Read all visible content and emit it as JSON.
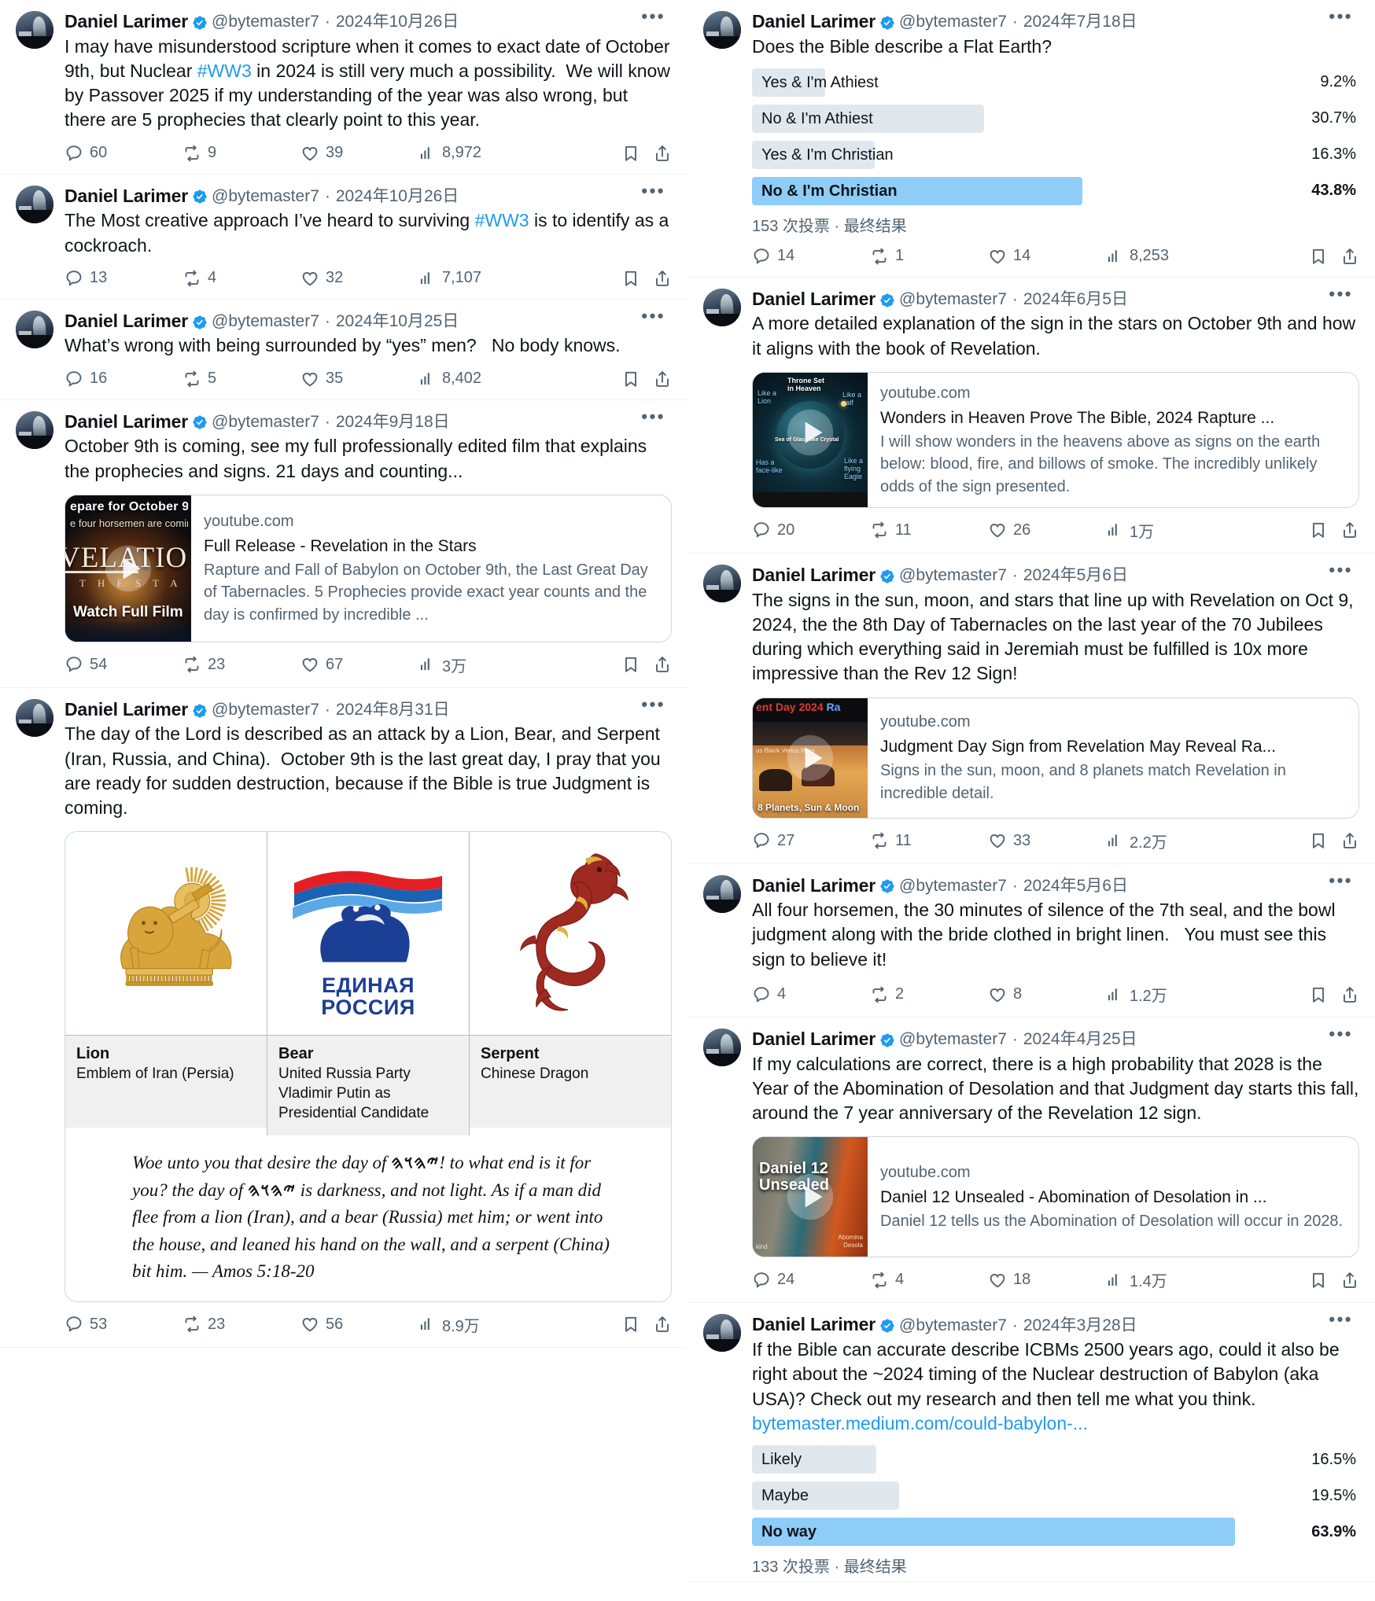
{
  "author": {
    "name": "Daniel Larimer",
    "handle": "@bytemaster7",
    "verified_icon": "verified-badge-icon"
  },
  "separator": "·",
  "left_column": [
    {
      "date": "2024年10月26日",
      "text_parts": [
        {
          "t": "I may have misunderstood scripture when it comes to exact date of October 9th, but Nuclear "
        },
        {
          "t": "#WW3",
          "link": true
        },
        {
          "t": " in 2024 is still very much a possibility.  We will know by Passover 2025 if my understanding of the year was also wrong, but there are 5 prophecies that clearly point to this year."
        }
      ],
      "stats": {
        "replies": "60",
        "retweets": "9",
        "likes": "39",
        "views": "8,972"
      }
    },
    {
      "date": "2024年10月26日",
      "text_parts": [
        {
          "t": "The Most creative approach I’ve heard to surviving "
        },
        {
          "t": "#WW3",
          "link": true
        },
        {
          "t": " is to identify as a cockroach."
        }
      ],
      "stats": {
        "replies": "13",
        "retweets": "4",
        "likes": "32",
        "views": "7,107"
      }
    },
    {
      "date": "2024年10月25日",
      "text_parts": [
        {
          "t": "What’s wrong with being surrounded by “yes” men?   No body knows."
        }
      ],
      "stats": {
        "replies": "16",
        "retweets": "5",
        "likes": "35",
        "views": "8,402"
      }
    },
    {
      "date": "2024年9月18日",
      "text_parts": [
        {
          "t": "October 9th is coming, see my full professionally edited film that explains the prophecies and signs. 21 days and counting..."
        }
      ],
      "card": {
        "domain": "youtube.com",
        "title": "Full Release - Revelation in the Stars",
        "desc": "Rapture and Fall of Babylon on October 9th, the Last Great Day of Tabernacles. 5 Prophecies provide exact year counts and the day is confirmed by incredible ...",
        "thumb": "revelation-thumbnail",
        "thumb_text": {
          "line1": "epare for October 9",
          "line2": "e four horsemen are coming",
          "big": "VELATIO",
          "sub": "T H E  S T A",
          "watch": "Watch Full Film"
        }
      },
      "stats": {
        "replies": "54",
        "retweets": "23",
        "likes": "67",
        "views": "3万"
      }
    },
    {
      "date": "2024年8月31日",
      "text_parts": [
        {
          "t": "The day of the Lord is described as an attack by a Lion, Bear, and Serpent (Iran, Russia, and China).  October 9th is the last great day, I pray that you are ready for sudden destruction, because if the Bible is true Judgment is coming."
        }
      ],
      "collage": {
        "cells": [
          {
            "title": "Lion",
            "desc": "Emblem of Iran (Persia)",
            "art": "iran-lion-sun-emblem"
          },
          {
            "title": "Bear",
            "desc": "United Russia Party\nVladimir Putin as\nPresidential Candidate",
            "art": "united-russia-bear-logo",
            "logo_text": "ЕДИНАЯ\nРОССИЯ"
          },
          {
            "title": "Serpent",
            "desc": "Chinese Dragon",
            "art": "chinese-dragon-emblem"
          }
        ],
        "quote_parts": [
          {
            "t": "Woe unto you that desire the day of "
          },
          {
            "t": "𐤉𐤄𐤅𐤄",
            "yhwh": true
          },
          {
            "t": "! to what end is it for you? the day of "
          },
          {
            "t": "𐤉𐤄𐤅𐤄",
            "yhwh": true
          },
          {
            "t": " is darkness, and not light. As if a man did flee from a lion (Iran), and a bear (Russia) met him; or went into the house, and leaned his hand on the wall, and a serpent (China) bit him. — Amos 5:18-20"
          }
        ]
      },
      "stats": {
        "replies": "53",
        "retweets": "23",
        "likes": "56",
        "views": "8.9万"
      }
    }
  ],
  "right_column": [
    {
      "date": "2024年7月18日",
      "text_parts": [
        {
          "t": "Does the Bible describe a Flat Earth?"
        }
      ],
      "poll": {
        "options": [
          {
            "label": "Yes & I'm Athiest",
            "pct": "9.2%",
            "value": 9.2,
            "winner": false
          },
          {
            "label": "No & I'm Athiest",
            "pct": "30.7%",
            "value": 30.7,
            "winner": false
          },
          {
            "label": "Yes & I'm Christian",
            "pct": "16.3%",
            "value": 16.3,
            "winner": false
          },
          {
            "label": "No & I'm Christian",
            "pct": "43.8%",
            "value": 43.8,
            "winner": true
          }
        ],
        "meta": "153 次投票 · 最终结果"
      },
      "stats": {
        "replies": "14",
        "retweets": "1",
        "likes": "14",
        "views": "8,253"
      }
    },
    {
      "date": "2024年6月5日",
      "text_parts": [
        {
          "t": "A more detailed explanation of the sign in the stars on October 9th and how it aligns with the book of Revelation."
        }
      ],
      "card": {
        "domain": "youtube.com",
        "title": "Wonders in Heaven Prove The Bible, 2024 Rapture ...",
        "desc": "I will show wonders in the heavens above as signs on the earth below: blood, fire, and billows of smoke. The incredibly unlikely odds of the sign presented.",
        "thumb": "wonders-in-heaven-thumbnail",
        "thumb_text": {
          "throne": "Throne Set\nin Heaven",
          "lion": "Like a\nLion",
          "calf": "Like a\ncalf",
          "sea": "Sea of Glass like Crystal",
          "face": "Has a\nface-like",
          "eagle": "Like a\nflying\nEagle"
        }
      },
      "stats": {
        "replies": "20",
        "retweets": "11",
        "likes": "26",
        "views": "1万"
      }
    },
    {
      "date": "2024年5月6日",
      "text_parts": [
        {
          "t": "The signs in the sun, moon, and stars that line up with Revelation on Oct 9, 2024, the the 8th Day of Tabernacles on the last year of the 70 Jubilees during which everything said in Jeremiah must be fulfilled is 10x more impressive than the Rev 12 Sign!"
        }
      ],
      "card": {
        "domain": "youtube.com",
        "title": "Judgment Day Sign from Revelation May Reveal Ra...",
        "desc": "Signs in the sun, moon, and 8 planets match Revelation in incredible detail.",
        "thumb": "judgment-day-thumbnail",
        "thumb_text": {
          "top": "ent Day 2024",
          "top_blue": "Ra",
          "planets": "us  Black Venus  Mars",
          "caption": "8 Planets, Sun & Moon"
        }
      },
      "stats": {
        "replies": "27",
        "retweets": "11",
        "likes": "33",
        "views": "2.2万"
      }
    },
    {
      "date": "2024年5月6日",
      "text_parts": [
        {
          "t": "All four horsemen, the 30 minutes of silence of the 7th seal, and the bowl judgment along with the bride clothed in bright linen.   You must see this sign to believe it!"
        }
      ],
      "stats": {
        "replies": "4",
        "retweets": "2",
        "likes": "8",
        "views": "1.2万"
      }
    },
    {
      "date": "2024年4月25日",
      "text_parts": [
        {
          "t": "If my calculations are correct, there is a high probability that 2028 is the Year of the Abomination of Desolation and that Judgment day starts this fall, around the 7 year anniversary of the Revelation 12 sign."
        }
      ],
      "card": {
        "domain": "youtube.com",
        "title": "Daniel 12 Unsealed - Abomination of Desolation in ...",
        "desc": "Daniel 12 tells us the Abomination of Desolation will occur in 2028.",
        "thumb": "daniel-12-unsealed-thumbnail",
        "thumb_text": {
          "title": "Daniel 12\nUnsealed",
          "right": "Abomina\nDesola",
          "left": "kind"
        }
      },
      "stats": {
        "replies": "24",
        "retweets": "4",
        "likes": "18",
        "views": "1.4万"
      }
    },
    {
      "date": "2024年3月28日",
      "text_parts": [
        {
          "t": "If the Bible can accurate describe ICBMs 2500 years ago, could it also be right about the ~2024 timing of the Nuclear destruction of Babylon (aka USA)? Check out my research and then tell me what you think.\n"
        },
        {
          "t": "bytemaster.medium.com/could-babylon-...",
          "link": true
        }
      ],
      "poll": {
        "options": [
          {
            "label": "Likely",
            "pct": "16.5%",
            "value": 16.5,
            "winner": false
          },
          {
            "label": "Maybe",
            "pct": "19.5%",
            "value": 19.5,
            "winner": false
          },
          {
            "label": "No way",
            "pct": "63.9%",
            "value": 63.9,
            "winner": true
          }
        ],
        "meta": "133 次投票 · 最终结果"
      }
    }
  ],
  "icons": {
    "reply": "reply-icon",
    "retweet": "retweet-icon",
    "like": "like-icon",
    "views": "views-icon",
    "bookmark": "bookmark-icon",
    "share": "share-icon",
    "more": "more-options-icon",
    "play": "play-button-icon"
  },
  "colors": {
    "link": "#1d9bf0",
    "verified": "#1d9bf0",
    "muted": "#536471",
    "poll_bar": "#e1e8ed",
    "poll_bar_winner": "#8ecdf8",
    "border": "#cfd9de"
  }
}
